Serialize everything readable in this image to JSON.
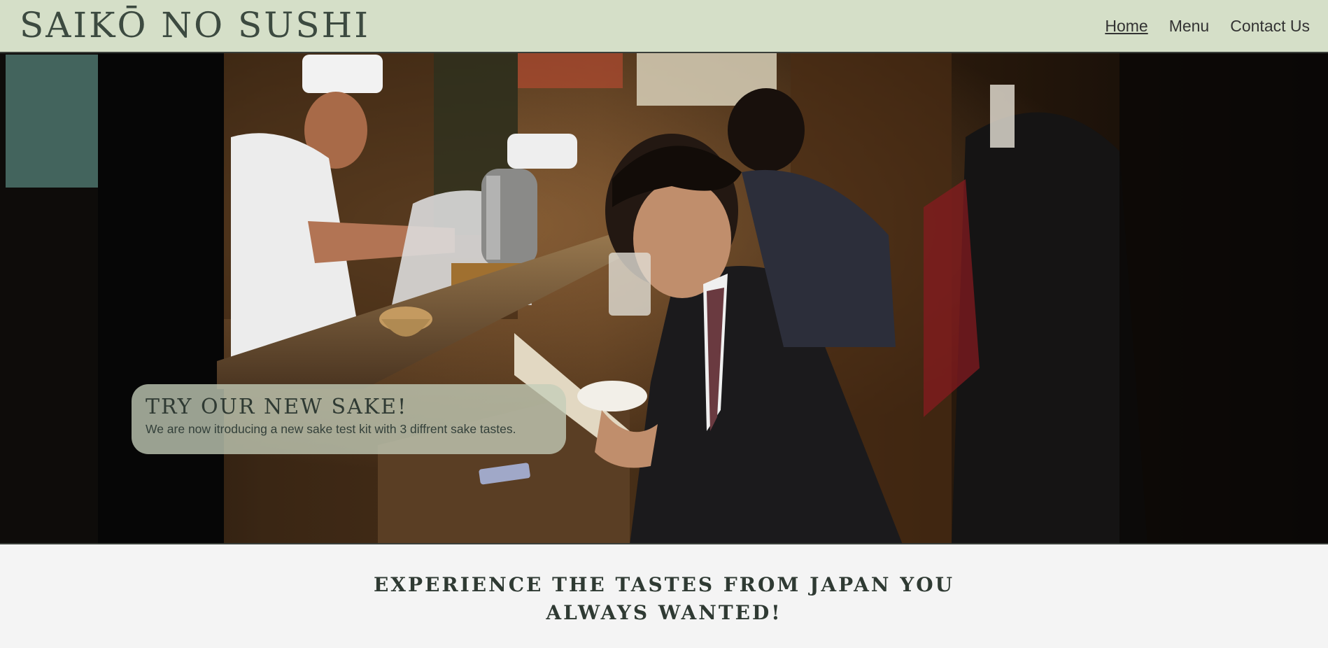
{
  "header": {
    "logo": "SAIKŌ NO SUSHI",
    "nav": [
      {
        "label": "Home",
        "active": true
      },
      {
        "label": "Menu",
        "active": false
      },
      {
        "label": "Contact Us",
        "active": false
      }
    ]
  },
  "hero": {
    "promo_title": "TRY OUR NEW SAKE!",
    "promo_text": "We are now itroducing a new sake test kit with 3 diffrent sake tastes."
  },
  "tagline": "EXPERIENCE THE TASTES FROM JAPAN YOU ALWAYS WANTED!",
  "colors": {
    "header_bg": "#d5dfc8",
    "text_dark": "#2f3a33",
    "page_bg": "#f4f4f4"
  }
}
